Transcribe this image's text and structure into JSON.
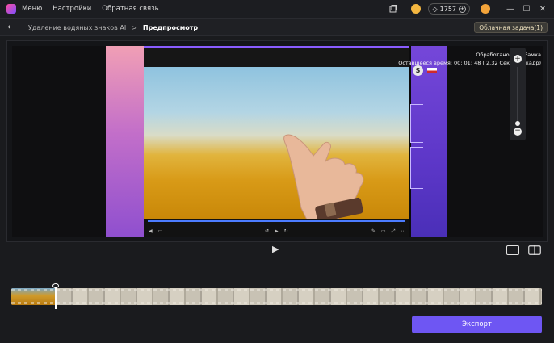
{
  "titlebar": {
    "menu": [
      "Меню",
      "Настройки",
      "Обратная связь"
    ],
    "credits": "1757"
  },
  "navbar": {
    "breadcrumb_parent": "Удаление водяных знаков AI",
    "breadcrumb_separator": ">",
    "breadcrumb_current": "Предпросмотр",
    "cloud_task_label": "Облачная задача(1)"
  },
  "preview": {
    "stats_line1": "Обработано 6/60 Рамка",
    "stats_line2": "Оставшееся время: 00: 01: 48  ( 2.32 Секунды/кадр)"
  },
  "playback": {
    "play_icon": "play-icon"
  },
  "timeline": {
    "playhead_fraction": 0.084
  },
  "footer": {
    "export_label": "Экспорт"
  },
  "colors": {
    "accent": "#6e56f3",
    "background": "#1a1b1e"
  }
}
